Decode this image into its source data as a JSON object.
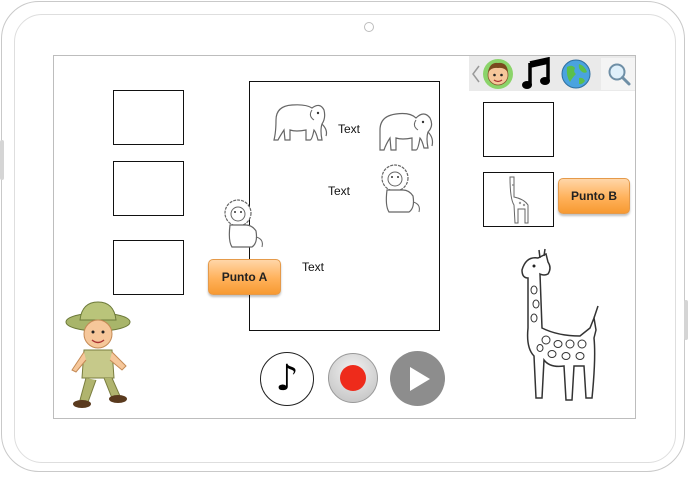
{
  "device": {
    "frame": "tablet-landscape"
  },
  "toolbar": {
    "icons": [
      "chevron-left-icon",
      "boy-face-icon",
      "music-note-icon",
      "globe-icon",
      "magnifier-icon"
    ]
  },
  "left_column": {
    "boxes_count": 3
  },
  "center_panel": {
    "label_1": "Text",
    "label_2": "Text",
    "label_3": "Text",
    "images": [
      "elephant",
      "elephant",
      "lion",
      "lion"
    ]
  },
  "buttons": {
    "punto_a": "Punto A",
    "punto_b": "Punto B"
  },
  "controls": {
    "note": "♪",
    "record": "record-icon",
    "play": "play-icon"
  },
  "illustrations": [
    "explorer-boy",
    "giraffe"
  ],
  "colors": {
    "punto_orange": "#ffb15a",
    "record_red": "#ee2b1b",
    "play_gray": "#8d8d8d",
    "toolbar_bg": "#eaeaea"
  }
}
